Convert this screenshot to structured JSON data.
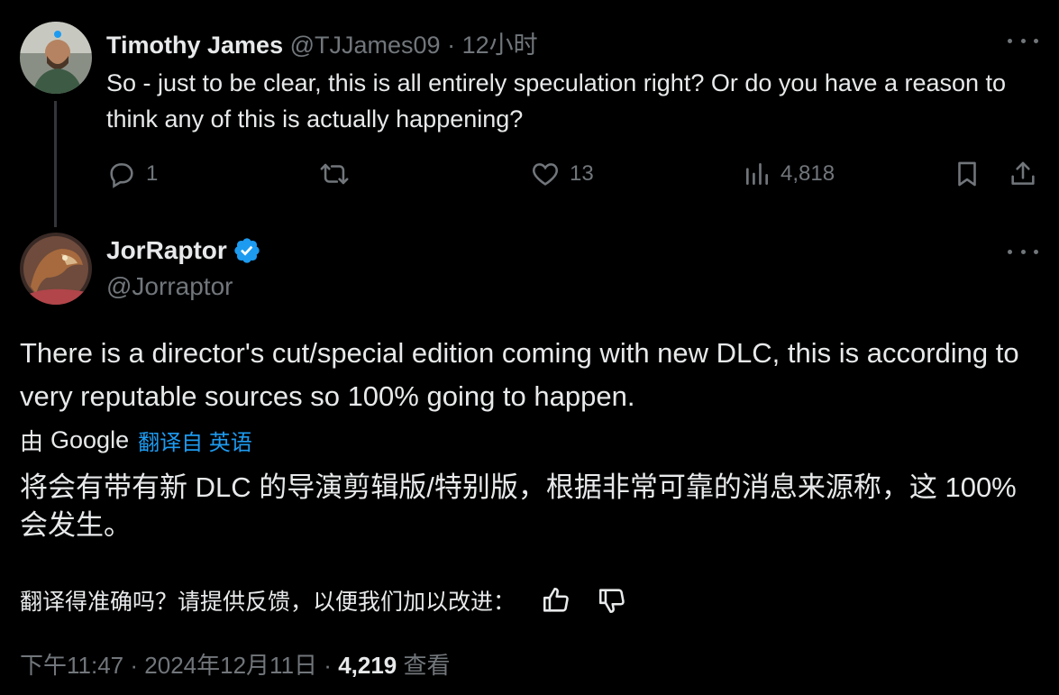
{
  "reply": {
    "name": "Timothy James",
    "handle": "@TJJames09",
    "time": "12小时",
    "text": "So - just to be clear, this is all entirely speculation right? Or do you have a reason to think any of this is actually happening?",
    "stats": {
      "replies": "1",
      "likes": "13",
      "views": "4,818"
    }
  },
  "tweet": {
    "name": "JorRaptor",
    "handle": "@Jorraptor",
    "text": "There is a director's cut/special edition coming with new DLC, this is according to very reputable sources so 100% going to happen.",
    "translation": {
      "by_label": "由",
      "provider": "Google",
      "link": "翻译自 英语",
      "text": "将会有带有新 DLC 的导演剪辑版/特别版，根据非常可靠的消息来源称，这 100% 会发生。"
    },
    "feedback": "翻译得准确吗？请提供反馈，以便我们加以改进：",
    "time": "下午11:47",
    "date": "2024年12月11日",
    "views": "4,219",
    "views_label": "查看"
  },
  "colors": {
    "accent": "#1d9bf0",
    "muted": "#71767b",
    "text": "#e7e9ea",
    "background": "#000000"
  },
  "icons": [
    "reply-icon",
    "retweet-icon",
    "like-icon",
    "views-icon",
    "bookmark-icon",
    "share-icon",
    "verified-icon",
    "thumbs-up-icon",
    "thumbs-down-icon",
    "more-icon"
  ]
}
